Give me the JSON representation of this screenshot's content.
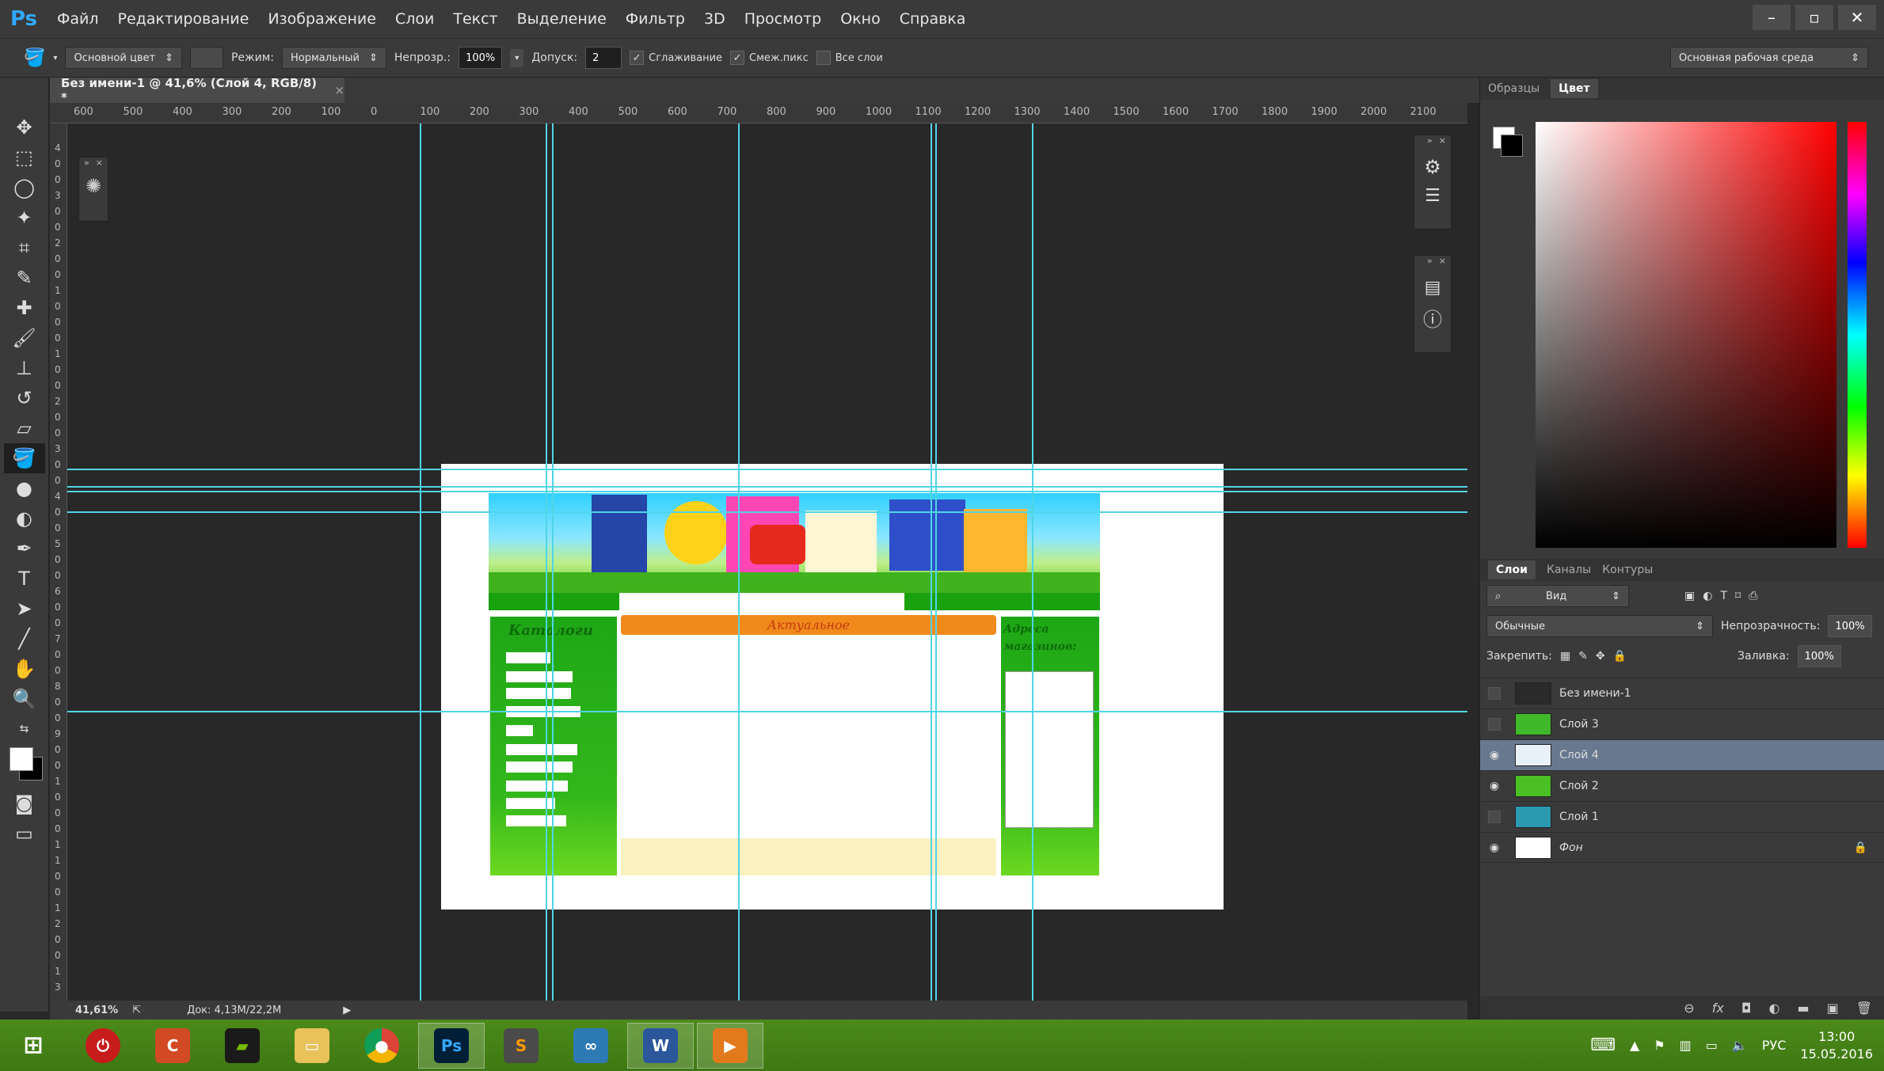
{
  "app": {
    "logo": "Ps"
  },
  "menu": [
    "Файл",
    "Редактирование",
    "Изображение",
    "Слои",
    "Текст",
    "Выделение",
    "Фильтр",
    "3D",
    "Просмотр",
    "Окно",
    "Справка"
  ],
  "window_controls": [
    "–",
    "▫",
    "✕"
  ],
  "options": {
    "source": "Основной цвет",
    "mode_label": "Режим:",
    "mode_value": "Нормальный",
    "opacity_label": "Непрозр.:",
    "opacity_value": "100%",
    "tolerance_label": "Допуск:",
    "tolerance_value": "2",
    "antialias": "Сглаживание",
    "contiguous": "Смеж.пикс",
    "all_layers": "Все слои",
    "workspace": "Основная рабочая среда"
  },
  "document": {
    "tab_title": "Без имени-1 @ 41,6% (Слой 4, RGB/8) *",
    "close": "×",
    "ruler_labels": [
      "600",
      "500",
      "400",
      "300",
      "200",
      "100",
      "0",
      "100",
      "200",
      "300",
      "400",
      "500",
      "600",
      "700",
      "800",
      "900",
      "1000",
      "1100",
      "1200",
      "1300",
      "1400",
      "1500",
      "1600",
      "1700",
      "1800",
      "1900",
      "2000",
      "2100"
    ],
    "left_ruler_labels": [
      "4",
      "0",
      "0",
      "3",
      "0",
      "0",
      "2",
      "0",
      "0",
      "1",
      "0",
      "0",
      "0",
      "1",
      "0",
      "0",
      "2",
      "0",
      "0",
      "3",
      "0",
      "0",
      "4",
      "0",
      "0",
      "5",
      "0",
      "0",
      "6",
      "0",
      "0",
      "7",
      "0",
      "0",
      "8",
      "0",
      "0",
      "9",
      "0",
      "0",
      "1",
      "0",
      "0",
      "0",
      "1",
      "1",
      "0",
      "0",
      "1",
      "2",
      "0",
      "0",
      "1",
      "3"
    ]
  },
  "site_mock": {
    "left_title": "Каталоги",
    "center_title": "Актуальное",
    "right_title": "Адреса магазинов:"
  },
  "status": {
    "zoom": "41,61%",
    "doc": "Док: 4,13M/22,2M"
  },
  "right_panel": {
    "top_tabs": [
      "Образцы",
      "Цвет"
    ],
    "layer_tabs": [
      "Слои",
      "Каналы",
      "Контуры"
    ],
    "filter_kind": "Вид",
    "blend_mode": "Обычные",
    "opacity_label": "Непрозрачность:",
    "opacity_value": "100%",
    "lock_label": "Закрепить:",
    "fill_label": "Заливка:",
    "fill_value": "100%",
    "layers": [
      {
        "name": "Без имени-1",
        "visible": false,
        "thumb": "#2a2a2a"
      },
      {
        "name": "Слой 3",
        "visible": false,
        "thumb": "#3fb82a"
      },
      {
        "name": "Слой 4",
        "visible": true,
        "thumb": "#e8f0f8"
      },
      {
        "name": "Слой 2",
        "visible": true,
        "thumb": "#4ac025"
      },
      {
        "name": "Слой 1",
        "visible": false,
        "thumb": "#2b9ab0"
      },
      {
        "name": "Фон",
        "visible": true,
        "thumb": "#ffffff"
      }
    ]
  },
  "taskbar": {
    "apps": [
      "windows-start",
      "power",
      "ccleaner",
      "nvidia",
      "explorer",
      "chrome",
      "photoshop",
      "sublime",
      "visual-studio",
      "word",
      "media"
    ],
    "lang": "РУС",
    "time": "13:00",
    "date": "15.05.2016"
  },
  "colors": {
    "guide": "#4fd5e6",
    "selected_layer": "#68788f",
    "taskbar": "#4c8a1b"
  }
}
